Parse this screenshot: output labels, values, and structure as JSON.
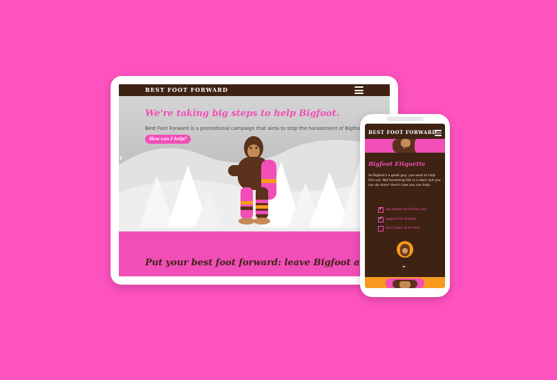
{
  "colors": {
    "background": "#fd52c0",
    "brand_brown": "#3e2313",
    "brand_pink": "#f14eb8",
    "brand_orange": "#f79a1e"
  },
  "tablet": {
    "nav": {
      "brand": "BEST FOOT FORWARD",
      "menu_icon": "hamburger-icon"
    },
    "hero": {
      "headline": "We're taking big steps to help Bigfoot.",
      "description": "Best Foot Forward is a promotional campaign that aims to stop the harassment of Bigfoot.",
      "cta_label": "How can I help?",
      "prev_icon": "chevron-left-icon"
    },
    "footer_section": {
      "headline": "Put your best foot forward: leave Bigfoot alone."
    }
  },
  "phone": {
    "nav": {
      "brand": "BEST FOOT FORWARD",
      "menu_icon": "hamburger-icon"
    },
    "etiquette": {
      "title": "Bigfoot Etiquette",
      "intro": "So Bigfoot's a great guy; you want to help him out. Not harassing him is a start, but you can do more! Here's how you can help:",
      "items": [
        {
          "label": "say please and thank you",
          "checked": true
        },
        {
          "label": "support his dreams",
          "checked": true
        },
        {
          "label": "don't stare at his feet",
          "checked": false
        }
      ]
    },
    "next_icon": "chevron-down-icon"
  }
}
